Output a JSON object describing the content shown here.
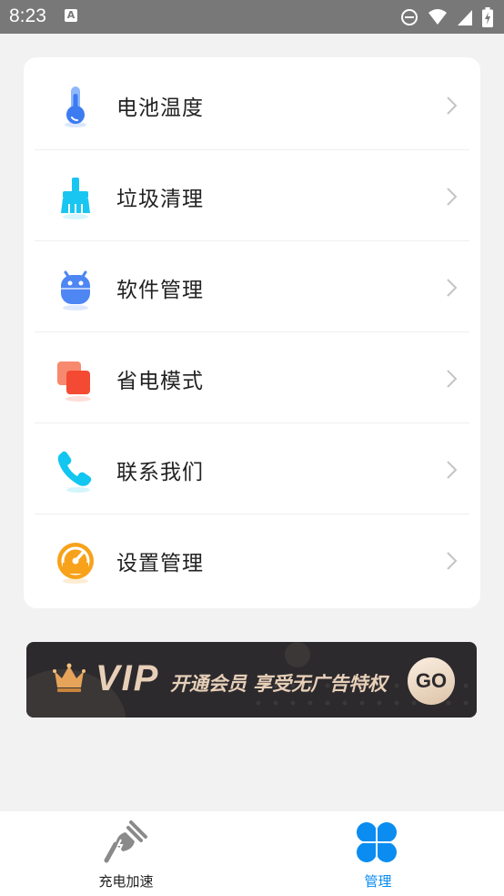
{
  "status_bar": {
    "time": "8:23",
    "notification_badge": "A"
  },
  "menu": {
    "items": [
      {
        "label": "电池温度",
        "icon": "thermometer-icon",
        "color": "#3d7bf0"
      },
      {
        "label": "垃圾清理",
        "icon": "broom-icon",
        "color": "#19c6f2"
      },
      {
        "label": "软件管理",
        "icon": "android-icon",
        "color": "#4e86f3"
      },
      {
        "label": "省电模式",
        "icon": "layers-icon",
        "color": "#f44a33"
      },
      {
        "label": "联系我们",
        "icon": "phone-icon",
        "color": "#11c6f0"
      },
      {
        "label": "设置管理",
        "icon": "speedometer-icon",
        "color": "#f7a21a"
      }
    ]
  },
  "vip_banner": {
    "title": "VIP",
    "slogan": "开通会员 享受无广告特权",
    "button": "GO",
    "accent": "#e7cfb8"
  },
  "bottom_nav": {
    "tabs": [
      {
        "label": "充电加速",
        "icon": "plug-icon",
        "active": false,
        "color": "#222222"
      },
      {
        "label": "管理",
        "icon": "grid-icon",
        "active": true,
        "color": "#0a8cf0"
      }
    ]
  }
}
